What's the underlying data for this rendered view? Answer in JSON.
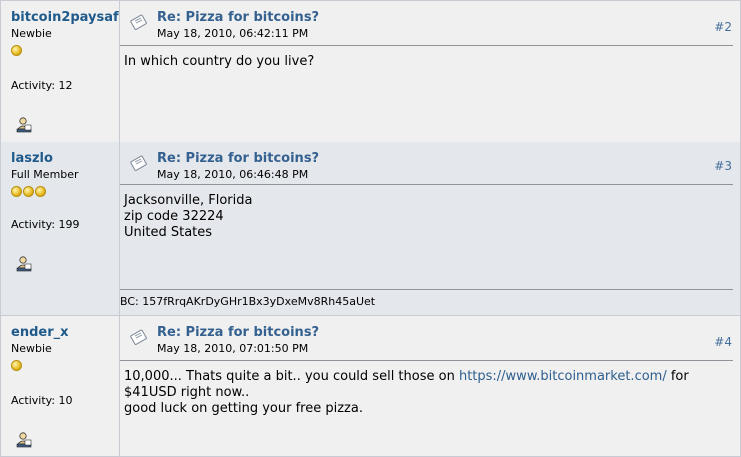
{
  "posts": [
    {
      "username": "bitcoin2paysafe",
      "rank": "Newbie",
      "stars": 1,
      "activity": "Activity: 12",
      "subject": "Re: Pizza for bitcoins?",
      "date": "May 18, 2010, 06:42:11 PM",
      "number": "#2",
      "lines": [
        "In which country do you live?"
      ]
    },
    {
      "username": "laszlo",
      "rank": "Full Member",
      "stars": 3,
      "activity": "Activity: 199",
      "subject": "Re: Pizza for bitcoins?",
      "date": "May 18, 2010, 06:46:48 PM",
      "number": "#3",
      "lines": [
        "Jacksonville, Florida",
        "zip code 32224",
        "United States"
      ],
      "signature": "BC: 157fRrqAKrDyGHr1Bx3yDxeMv8Rh45aUet"
    },
    {
      "username": "ender_x",
      "rank": "Newbie",
      "stars": 1,
      "activity": "Activity: 10",
      "subject": "Re: Pizza for bitcoins?",
      "date": "May 18, 2010, 07:01:50 PM",
      "number": "#4",
      "line1_before": "10,000... Thats quite a bit.. you could sell those on ",
      "link": "https://www.bitcoinmarket.com/",
      "line1_after": " for",
      "line2": "$41USD right now..",
      "line3": "good luck on getting your free pizza."
    }
  ],
  "colors": {
    "username": "#1f5a8b",
    "link": "#2d5e8e",
    "bg_alt": "#e4e7ec",
    "bg": "#f0f0f0"
  }
}
